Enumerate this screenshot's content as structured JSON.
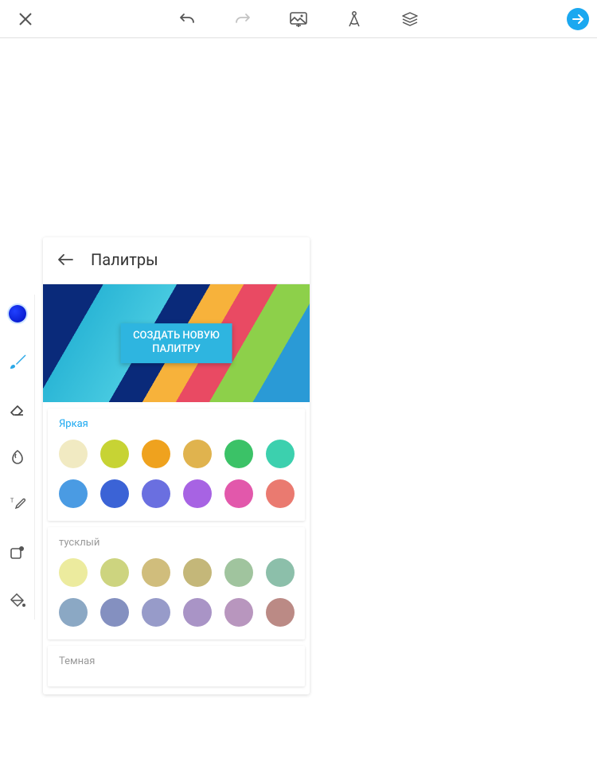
{
  "topbar": {
    "close": "close",
    "undo": "undo",
    "redo": "redo",
    "image": "image",
    "shapes": "shapes",
    "layers": "layers",
    "done": "done"
  },
  "sidebar": {
    "color": "color",
    "brush": "brush",
    "eraser": "eraser",
    "smudge": "smudge",
    "text": "text",
    "shape": "shape",
    "fill": "fill"
  },
  "panel": {
    "title": "Палитры",
    "create_line1": "СОЗДАТЬ НОВУЮ",
    "create_line2": "ПАЛИТРУ",
    "palettes": [
      {
        "name": "Яркая",
        "bright": true,
        "colors": [
          "#f1eac2",
          "#c7d334",
          "#efa21e",
          "#e0b34e",
          "#3bc267",
          "#3cd0ae",
          "#4a9be3",
          "#3b63d6",
          "#6a6fe0",
          "#a763e3",
          "#e258ab",
          "#ea7a70"
        ]
      },
      {
        "name": "тусклый",
        "bright": false,
        "colors": [
          "#eceb9e",
          "#cdd47f",
          "#d0bd7c",
          "#c4b779",
          "#a0c49e",
          "#8cbfaa",
          "#8ba8c4",
          "#8490c0",
          "#979bc9",
          "#a994c6",
          "#b896be",
          "#bb8a85"
        ]
      }
    ],
    "dark_name": "Темная"
  }
}
